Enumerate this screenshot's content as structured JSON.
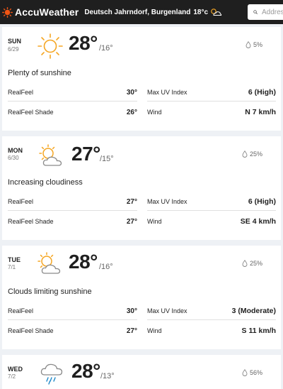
{
  "header": {
    "brand": "AccuWeather",
    "location": "Deutsch Jahrndorf, Burgenland",
    "current_temp": "18°c",
    "search_placeholder": "Address"
  },
  "days": [
    {
      "day": "SUN",
      "date": "6/29",
      "icon": "sunny-icon",
      "high": "28°",
      "low": "/16°",
      "precip": "5%",
      "phrase": "Plenty of sunshine",
      "realfeel_label": "RealFeel",
      "realfeel": "30°",
      "uv_label": "Max UV Index",
      "uv": "6 (High)",
      "shade_label": "RealFeel Shade",
      "shade": "26°",
      "wind_label": "Wind",
      "wind": "N 7 km/h"
    },
    {
      "day": "MON",
      "date": "6/30",
      "icon": "partly-cloudy-icon",
      "high": "27°",
      "low": "/15°",
      "precip": "25%",
      "phrase": "Increasing cloudiness",
      "realfeel_label": "RealFeel",
      "realfeel": "27°",
      "uv_label": "Max UV Index",
      "uv": "6 (High)",
      "shade_label": "RealFeel Shade",
      "shade": "27°",
      "wind_label": "Wind",
      "wind": "SE 4 km/h"
    },
    {
      "day": "TUE",
      "date": "7/1",
      "icon": "partly-cloudy-icon",
      "high": "28°",
      "low": "/16°",
      "precip": "25%",
      "phrase": "Clouds limiting sunshine",
      "realfeel_label": "RealFeel",
      "realfeel": "30°",
      "uv_label": "Max UV Index",
      "uv": "3 (Moderate)",
      "shade_label": "RealFeel Shade",
      "shade": "27°",
      "wind_label": "Wind",
      "wind": "S 11 km/h"
    },
    {
      "day": "WED",
      "date": "7/2",
      "icon": "rain-cloud-icon",
      "high": "28°",
      "low": "/13°",
      "precip": "56%"
    }
  ],
  "colors": {
    "header_bg": "#1f1f1f",
    "accent": "#f05514",
    "sun": "#f5a623",
    "page_bg": "#eef1f5"
  }
}
